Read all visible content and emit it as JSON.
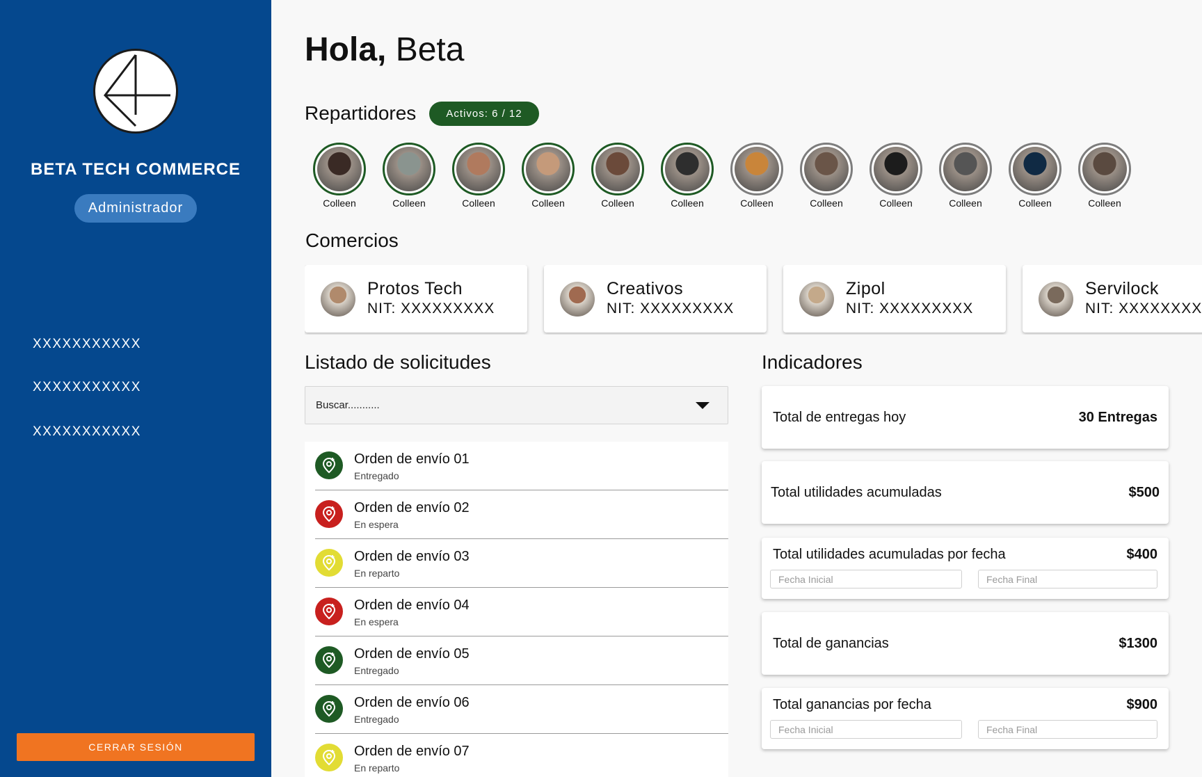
{
  "sidebar": {
    "brand": "BETA TECH COMMERCE",
    "role": "Administrador",
    "nav": [
      "XXXXXXXXXXX",
      "XXXXXXXXXXX",
      "XXXXXXXXXXX"
    ],
    "logout_label": "CERRAR SESIÓN"
  },
  "header": {
    "greeting_bold": "Hola,",
    "greeting_name": "Beta"
  },
  "couriers": {
    "title": "Repartidores",
    "badge": "Activos: 6 / 12",
    "items": [
      {
        "name": "Colleen",
        "active": true,
        "tone": "#3a2a25"
      },
      {
        "name": "Colleen",
        "active": true,
        "tone": "#8a948f"
      },
      {
        "name": "Colleen",
        "active": true,
        "tone": "#b07a5e"
      },
      {
        "name": "Colleen",
        "active": true,
        "tone": "#c59a7a"
      },
      {
        "name": "Colleen",
        "active": true,
        "tone": "#6b4a3a"
      },
      {
        "name": "Colleen",
        "active": true,
        "tone": "#2e2e2e"
      },
      {
        "name": "Colleen",
        "active": false,
        "tone": "#c9853a"
      },
      {
        "name": "Colleen",
        "active": false,
        "tone": "#6a5548"
      },
      {
        "name": "Colleen",
        "active": false,
        "tone": "#1c1c1c"
      },
      {
        "name": "Colleen",
        "active": false,
        "tone": "#555555"
      },
      {
        "name": "Colleen",
        "active": false,
        "tone": "#102a44"
      },
      {
        "name": "Colleen",
        "active": false,
        "tone": "#5a4a40"
      }
    ]
  },
  "shops": {
    "title": "Comercios",
    "items": [
      {
        "name": "Protos Tech",
        "nit": "NIT: XXXXXXXXX",
        "tone": "#b08a6c"
      },
      {
        "name": "Creativos",
        "nit": "NIT: XXXXXXXXX",
        "tone": "#a06a50"
      },
      {
        "name": "Zipol",
        "nit": "NIT: XXXXXXXXX",
        "tone": "#c4a98a"
      },
      {
        "name": "Servilock",
        "nit": "NIT: XXXXXXXXX",
        "tone": "#7a6a5c"
      }
    ]
  },
  "requests": {
    "title": "Listado de solicitudes",
    "search_placeholder": "Buscar...........",
    "orders": [
      {
        "title": "Orden de envío 01",
        "status": "Entregado",
        "color": "#1e5a24"
      },
      {
        "title": "Orden de envío 02",
        "status": "En espera",
        "color": "#c8201e"
      },
      {
        "title": "Orden de envío 03",
        "status": "En reparto",
        "color": "#e2dc34"
      },
      {
        "title": "Orden de envío 04",
        "status": "En espera",
        "color": "#c8201e"
      },
      {
        "title": "Orden de envío 05",
        "status": "Entregado",
        "color": "#1e5a24"
      },
      {
        "title": "Orden de envío 06",
        "status": "Entregado",
        "color": "#1e5a24"
      },
      {
        "title": "Orden de envío 07",
        "status": "En reparto",
        "color": "#e2dc34"
      }
    ]
  },
  "indicators": {
    "title": "Indicadores",
    "cards": [
      {
        "label": "Total de entregas hoy",
        "value": "30 Entregas"
      },
      {
        "label": "Total utilidades acumuladas",
        "value": "$500"
      },
      {
        "label": "Total utilidades acumuladas por fecha",
        "value": "$400",
        "start_placeholder": "Fecha Inicial",
        "end_placeholder": "Fecha Final"
      },
      {
        "label": "Total de ganancias",
        "value": "$1300"
      },
      {
        "label": "Total ganancias por fecha",
        "value": "$900",
        "start_placeholder": "Fecha Inicial",
        "end_placeholder": "Fecha Final"
      }
    ]
  },
  "colors": {
    "sidebar": "#05488e",
    "active": "#1e5a24",
    "logout": "#f07421"
  }
}
